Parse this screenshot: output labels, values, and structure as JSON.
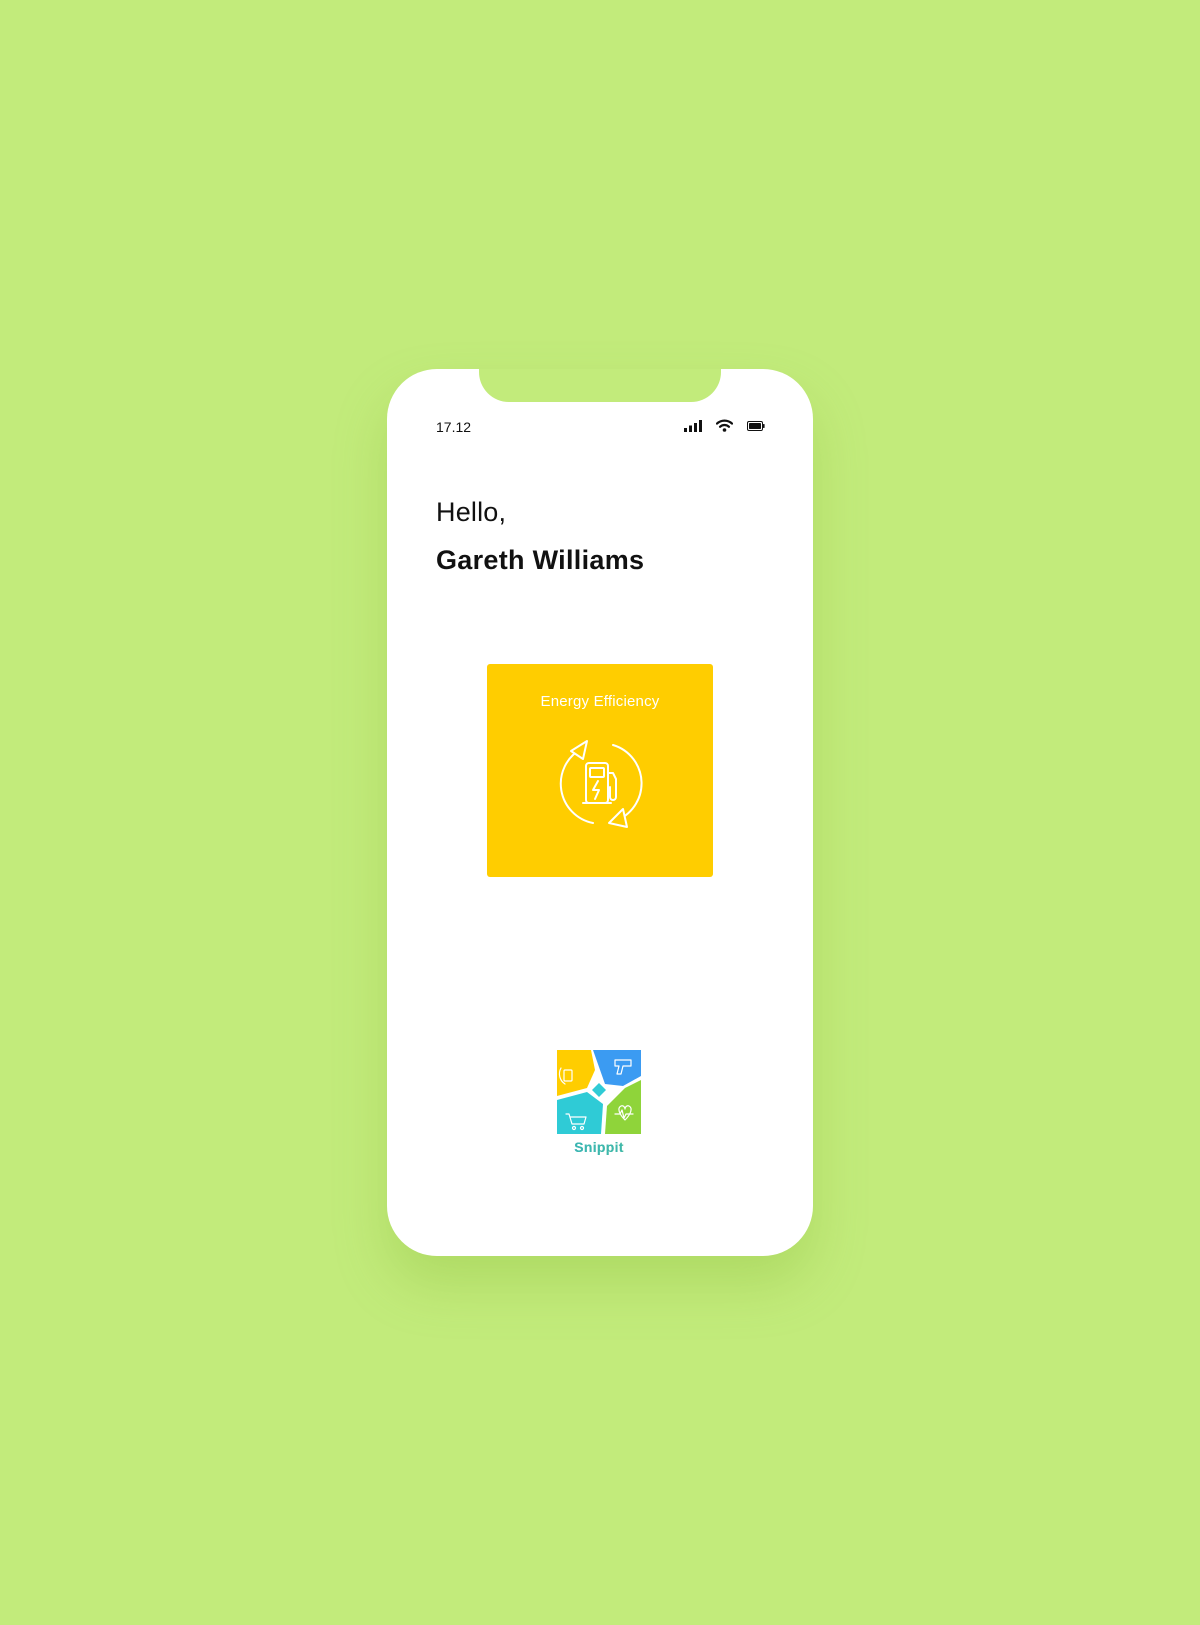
{
  "colors": {
    "background": "#c2eb7b",
    "card": "#ffcd00",
    "logo_yellow": "#ffcd00",
    "logo_blue": "#3b9bf2",
    "logo_teal": "#2fcbd6",
    "logo_green": "#8fd43a"
  },
  "status_bar": {
    "time": "17.12",
    "icons": [
      "signal-icon",
      "wifi-icon",
      "battery-icon"
    ]
  },
  "greeting": {
    "hello": "Hello,",
    "name": "Gareth Williams"
  },
  "card": {
    "title": "Energy Efficiency",
    "icon": "ev-charging-cycle-icon"
  },
  "logo": {
    "name": "Snippit"
  }
}
